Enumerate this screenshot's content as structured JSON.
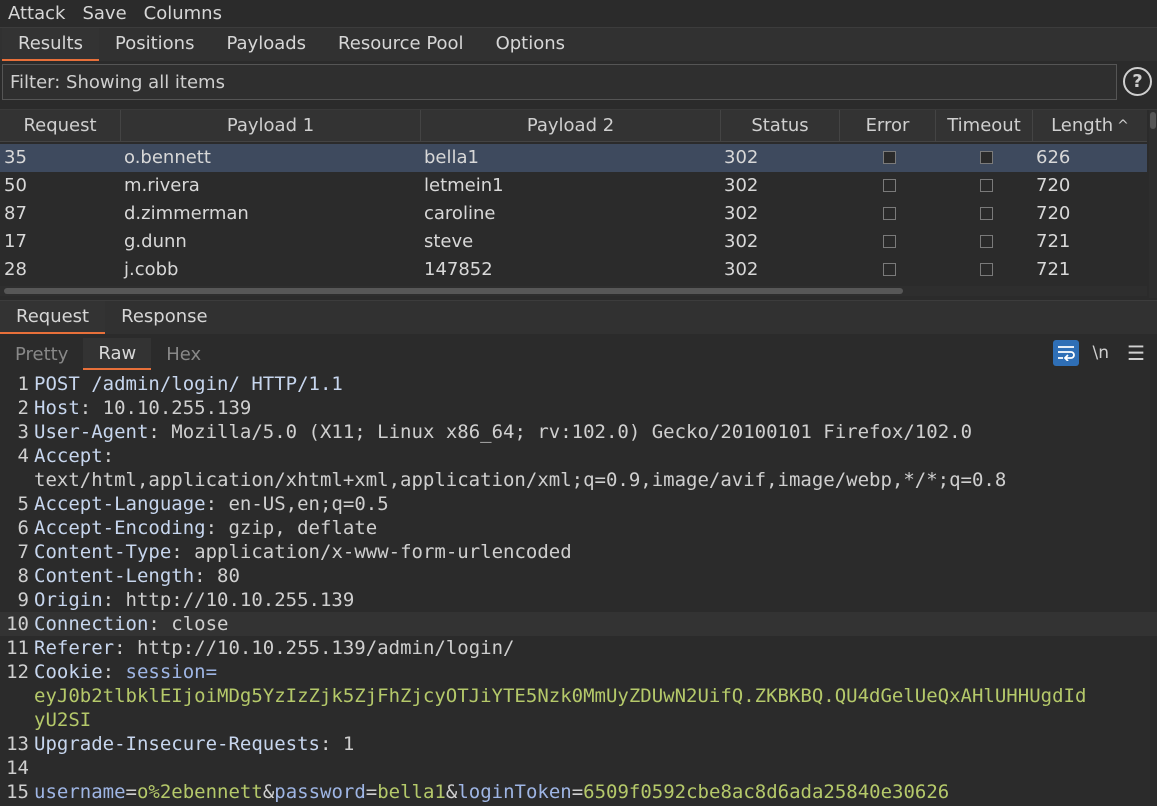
{
  "menu": {
    "attack": "Attack",
    "save": "Save",
    "columns": "Columns"
  },
  "tabs": [
    "Results",
    "Positions",
    "Payloads",
    "Resource Pool",
    "Options"
  ],
  "filter": {
    "text": "Filter: Showing all items",
    "help": "?"
  },
  "table": {
    "headers": [
      "Request",
      "Payload 1",
      "Payload 2",
      "Status",
      "Error",
      "Timeout",
      "Length"
    ],
    "sort_indicator": "^",
    "rows": [
      {
        "request": "35",
        "payload1": "o.bennett",
        "payload2": "bella1",
        "status": "302",
        "length": "626",
        "selected": true
      },
      {
        "request": "50",
        "payload1": "m.rivera",
        "payload2": "letmein1",
        "status": "302",
        "length": "720",
        "selected": false
      },
      {
        "request": "87",
        "payload1": "d.zimmerman",
        "payload2": "caroline",
        "status": "302",
        "length": "720",
        "selected": false
      },
      {
        "request": "17",
        "payload1": "g.dunn",
        "payload2": "steve",
        "status": "302",
        "length": "721",
        "selected": false
      },
      {
        "request": "28",
        "payload1": "j.cobb",
        "payload2": "147852",
        "status": "302",
        "length": "721",
        "selected": false
      }
    ]
  },
  "rr_tabs": [
    "Request",
    "Response"
  ],
  "sub_tabs": [
    "Pretty",
    "Raw",
    "Hex"
  ],
  "tools": {
    "newline": "\\n",
    "menu": "☰"
  },
  "editor": {
    "line_numbers": [
      "1",
      "2",
      "3",
      "4",
      "",
      "5",
      "6",
      "7",
      "8",
      "9",
      "10",
      "11",
      "12",
      "",
      "",
      "13",
      "14",
      "15"
    ],
    "lines": [
      {
        "k": "POST /admin/login/ HTTP/1.1",
        "v": ""
      },
      {
        "k": "Host",
        "v": "10.10.255.139"
      },
      {
        "k": "User-Agent",
        "v": "Mozilla/5.0 (X11; Linux x86_64; rv:102.0) Gecko/20100101 Firefox/102.0"
      },
      {
        "k": "Accept",
        "v": ""
      },
      {
        "k": "",
        "v": "text/html,application/xhtml+xml,application/xml;q=0.9,image/avif,image/webp,*/*;q=0.8"
      },
      {
        "k": "Accept-Language",
        "v": "en-US,en;q=0.5"
      },
      {
        "k": "Accept-Encoding",
        "v": "gzip, deflate"
      },
      {
        "k": "Content-Type",
        "v": "application/x-www-form-urlencoded"
      },
      {
        "k": "Content-Length",
        "v": "80"
      },
      {
        "k": "Origin",
        "v": "http://10.10.255.139"
      },
      {
        "k": "Connection",
        "v": "close"
      },
      {
        "k": "Referer",
        "v": "http://10.10.255.139/admin/login/"
      },
      {
        "k": "Cookie",
        "v": "session="
      },
      {
        "k": "",
        "v": "eyJ0b2tlbklEIjoiMDg5YzIzZjk5ZjFhZjcyOTJiYTE5Nzk0MmUyZDUwN2UifQ.ZKBKBQ.QU4dGelUeQxAHlUHHUgdId"
      },
      {
        "k": "",
        "v": "yU2SI"
      },
      {
        "k": "Upgrade-Insecure-Requests",
        "v": "1"
      },
      {
        "k": "",
        "v": ""
      },
      {
        "k": "",
        "v": ""
      }
    ],
    "body": {
      "k1": "username",
      "v1": "o%2ebennett",
      "k2": "password",
      "v2": "bella1",
      "k3": "loginToken",
      "v3": "6509f0592cbe8ac8d6ada25840e30626"
    }
  },
  "colors": {
    "accent": "#e8703a",
    "selection": "#3e4a5e",
    "wrap_button": "#2f6fb6"
  }
}
